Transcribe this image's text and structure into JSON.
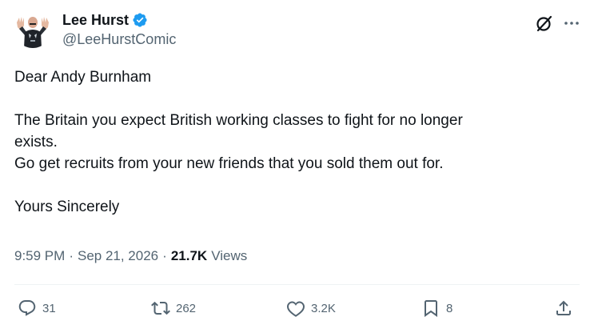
{
  "author": {
    "display_name": "Lee Hurst",
    "handle": "@LeeHurstComic",
    "verified": true,
    "verified_color": "#1d9bf0"
  },
  "tweet": {
    "lines": [
      "Dear Andy Burnham",
      "",
      "The Britain you expect British working classes to fight for no longer",
      "exists.",
      "Go get recruits from your new friends that you sold them out for.",
      "",
      "Yours Sincerely"
    ]
  },
  "meta": {
    "time": "9:59 PM",
    "separator": "·",
    "date": "Sep 21, 2026",
    "views_count": "21.7K",
    "views_label": "Views"
  },
  "actions": {
    "replies": "31",
    "reposts": "262",
    "likes": "3.2K",
    "bookmarks": "8"
  },
  "icons": {
    "avatar": "avatar-icon",
    "verified": "verified-badge-icon",
    "grok": "grok-icon",
    "more": "more-icon",
    "reply": "reply-icon",
    "repost": "repost-icon",
    "like": "heart-icon",
    "bookmark": "bookmark-icon",
    "share": "share-icon"
  },
  "colors": {
    "text_primary": "#0f1419",
    "text_secondary": "#536471",
    "divider": "#eff3f4"
  }
}
